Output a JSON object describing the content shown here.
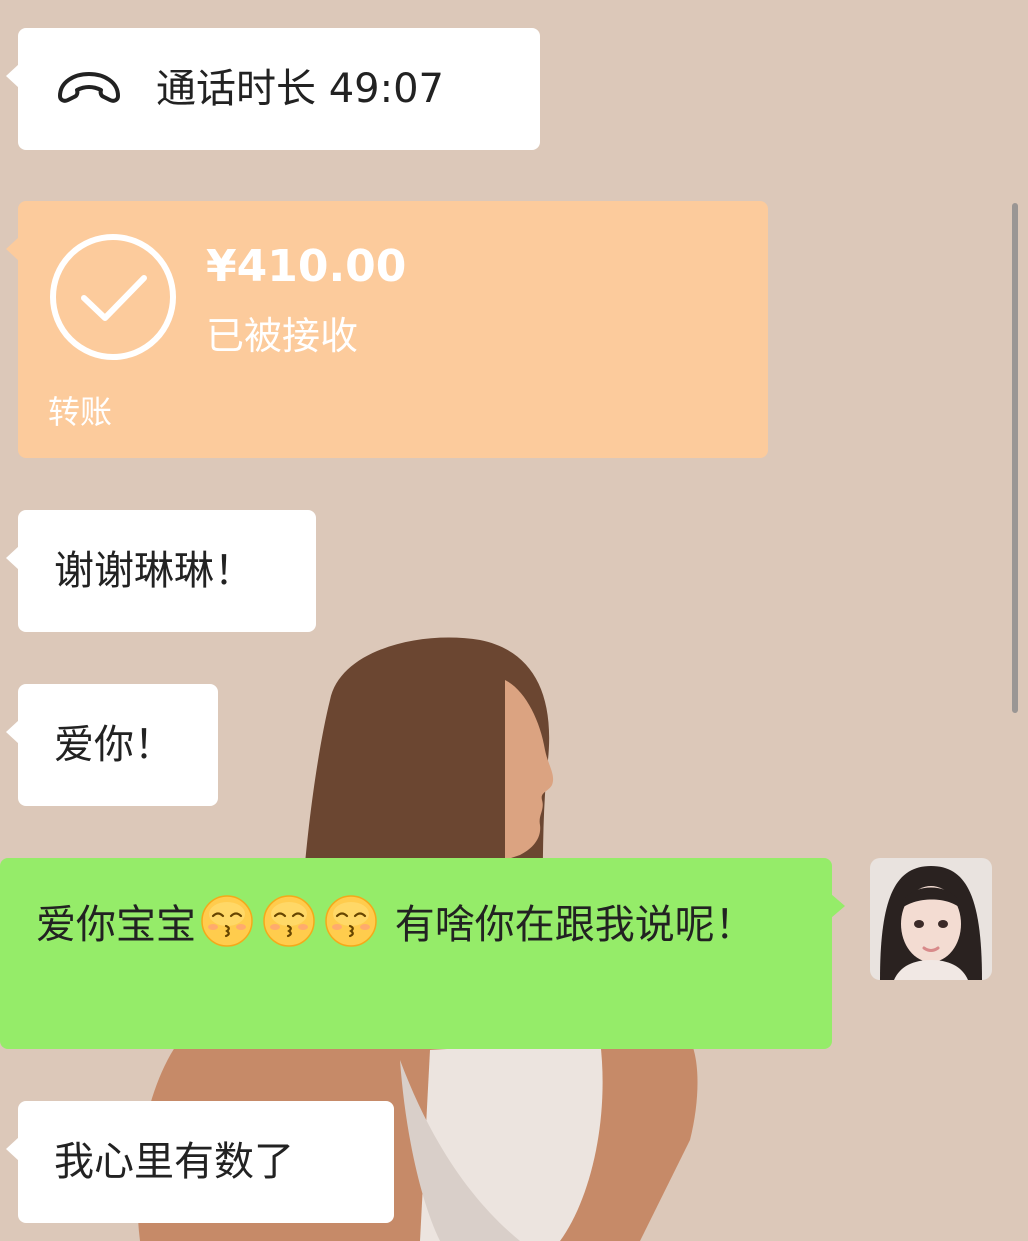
{
  "messages": {
    "call": {
      "icon": "phone-hangup-icon",
      "text": "通话时长 49:07"
    },
    "transfer": {
      "icon": "check-circle-icon",
      "amount": "¥410.00",
      "status": "已被接收",
      "label": "转账",
      "color": "#fccb9c"
    },
    "thanks": {
      "text": "谢谢琳琳！"
    },
    "love": {
      "text": "爱你！"
    },
    "reply": {
      "text_before": "爱你宝宝",
      "emojis": [
        "kissing-smiling-eyes-emoji",
        "kissing-smiling-eyes-emoji",
        "kissing-smiling-eyes-emoji"
      ],
      "text_after": " 有啥你在跟我说呢！",
      "color": "#95ec69"
    },
    "last": {
      "text": "我心里有数了"
    }
  },
  "avatar": {
    "icon": "user-avatar"
  }
}
